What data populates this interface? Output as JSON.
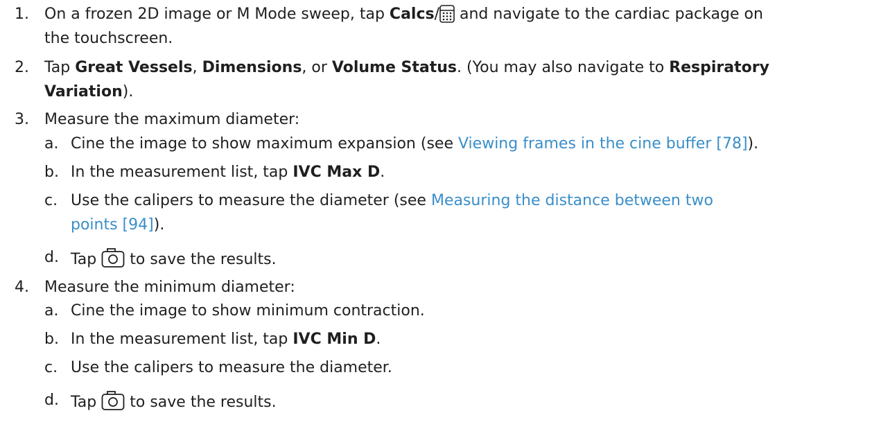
{
  "steps": [
    {
      "number": "1.",
      "text_a": "On a frozen 2D image or M Mode sweep, tap ",
      "bold_a": "Calcs",
      "sep": "/",
      "icon": "calculator-icon",
      "text_b": " and navigate to the cardiac package on",
      "text_c": "the touchscreen."
    },
    {
      "number": "2.",
      "text_a": "Tap ",
      "bold_a": "Great Vessels",
      "text_b": ", ",
      "bold_b": "Dimensions",
      "text_c": ", or ",
      "bold_c": "Volume Status",
      "text_d": ". (You may also navigate to ",
      "bold_d": "Respiratory",
      "bold_e": "Variation",
      "text_e": ")."
    },
    {
      "number": "3.",
      "text": "Measure the maximum diameter:",
      "substeps": [
        {
          "letter": "a.",
          "text_a": "Cine the image to show maximum expansion (see ",
          "link": "Viewing frames in the cine buffer [78]",
          "text_b": ")."
        },
        {
          "letter": "b.",
          "text_a": "In the measurement list, tap ",
          "bold": "IVC Max D",
          "text_b": "."
        },
        {
          "letter": "c.",
          "text_a": "Use the calipers to measure the diameter (see ",
          "link_a": "Measuring the distance between two",
          "link_b": "points [94]",
          "text_b": ")."
        },
        {
          "letter": "d.",
          "text_a": "Tap ",
          "icon": "camera-icon",
          "text_b": " to save the results."
        }
      ]
    },
    {
      "number": "4.",
      "text": "Measure the minimum diameter:",
      "substeps": [
        {
          "letter": "a.",
          "text": "Cine the image to show minimum contraction."
        },
        {
          "letter": "b.",
          "text_a": "In the measurement list, tap ",
          "bold": "IVC Min D",
          "text_b": "."
        },
        {
          "letter": "c.",
          "text": "Use the calipers to measure the diameter."
        },
        {
          "letter": "d.",
          "text_a": "Tap ",
          "icon": "camera-icon",
          "text_b": " to save the results."
        }
      ]
    }
  ],
  "colors": {
    "text": "#1f1f1f",
    "link": "#3a8ec9"
  }
}
